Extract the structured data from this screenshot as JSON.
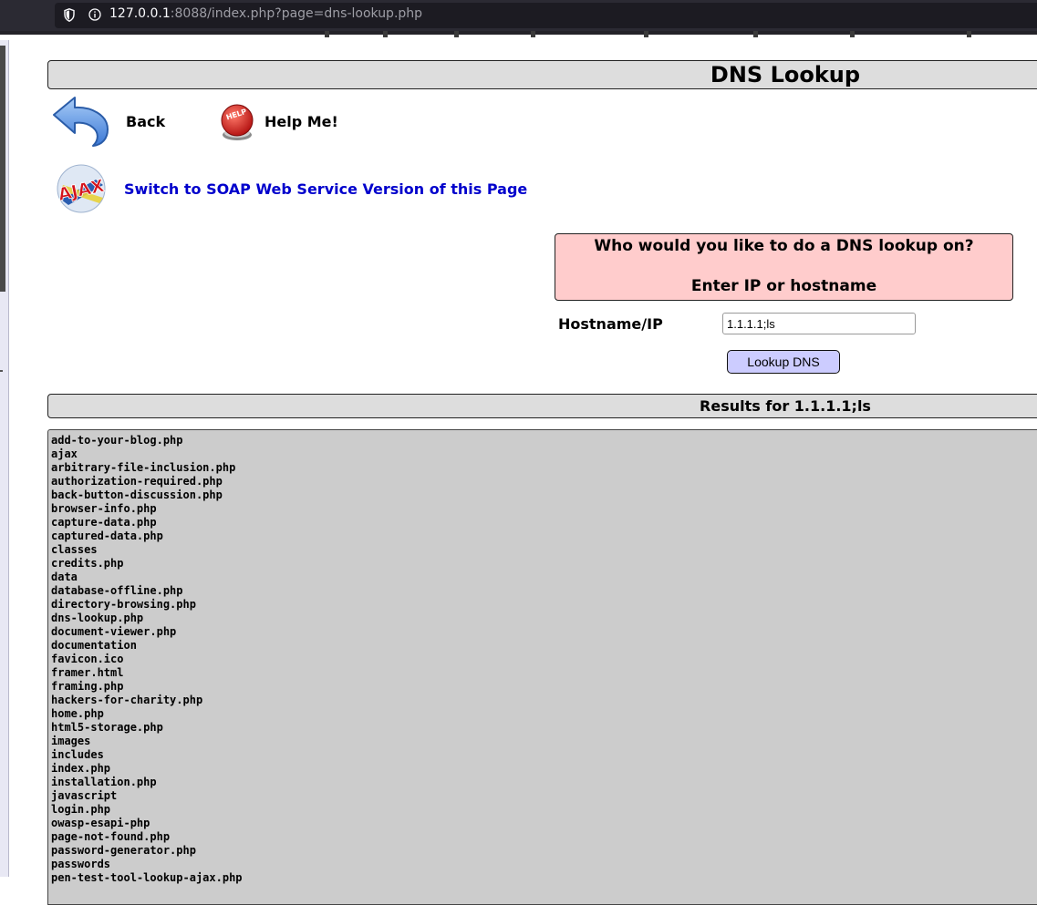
{
  "browser": {
    "url_host": "127.0.0.1",
    "url_rest": ":8088/index.php?page=dns-lookup.php"
  },
  "page": {
    "title": "DNS Lookup",
    "back_label": "Back",
    "help_label": "Help Me!",
    "soap_link": "Switch to SOAP Web Service Version of this Page",
    "instruction_line1": "Who would you like to do a DNS lookup on?",
    "instruction_line2": "Enter IP or hostname",
    "hostname_label": "Hostname/IP",
    "hostname_value": "1.1.1.1;ls",
    "lookup_button": "Lookup DNS",
    "results_title": "Results for 1.1.1.1;ls"
  },
  "icons": {
    "back": "back-arrow-icon",
    "help": "help-button-icon",
    "ajax": "ajax-logo-icon"
  },
  "colors": {
    "title_bg": "#dddddd",
    "instruction_bg": "#ffcccc",
    "button_bg": "#ccccff",
    "output_bg": "#cccccc",
    "link": "#0000cc"
  },
  "results": [
    "add-to-your-blog.php",
    "ajax",
    "arbitrary-file-inclusion.php",
    "authorization-required.php",
    "back-button-discussion.php",
    "browser-info.php",
    "capture-data.php",
    "captured-data.php",
    "classes",
    "credits.php",
    "data",
    "database-offline.php",
    "directory-browsing.php",
    "dns-lookup.php",
    "document-viewer.php",
    "documentation",
    "favicon.ico",
    "framer.html",
    "framing.php",
    "hackers-for-charity.php",
    "home.php",
    "html5-storage.php",
    "images",
    "includes",
    "index.php",
    "installation.php",
    "javascript",
    "login.php",
    "owasp-esapi-php",
    "page-not-found.php",
    "password-generator.php",
    "passwords",
    "pen-test-tool-lookup-ajax.php"
  ]
}
